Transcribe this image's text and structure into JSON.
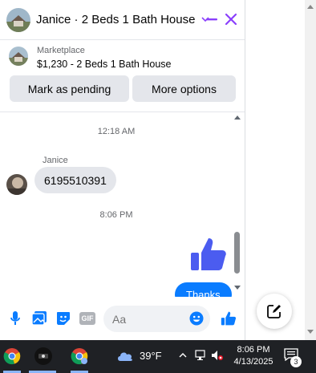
{
  "header": {
    "title": "Janice · 2 Beds 1 Bath House",
    "dropdown_icon": "chevron-down-icon",
    "minimize_icon": "minimize-icon",
    "close_icon": "close-icon"
  },
  "listing": {
    "category": "Marketplace",
    "summary": "$1,230 - 2 Beds 1 Bath House"
  },
  "actions": {
    "mark_pending": "Mark as pending",
    "more_options": "More options"
  },
  "thread": {
    "timestamp_1": "12:18 AM",
    "sender_name": "Janice",
    "incoming_message": "6195510391",
    "timestamp_2": "8:06 PM",
    "outgoing_message": "Thanks"
  },
  "composer": {
    "placeholder": "Aa",
    "gif_label": "GIF"
  },
  "taskbar": {
    "temperature": "39°F",
    "time": "8:06 PM",
    "date": "4/13/2025",
    "notification_count": "3"
  },
  "colors": {
    "accent": "#8a3ffc",
    "messenger_blue": "#0a7cff",
    "like_blue": "#4b5cf0",
    "taskbar": "#1f2125"
  }
}
